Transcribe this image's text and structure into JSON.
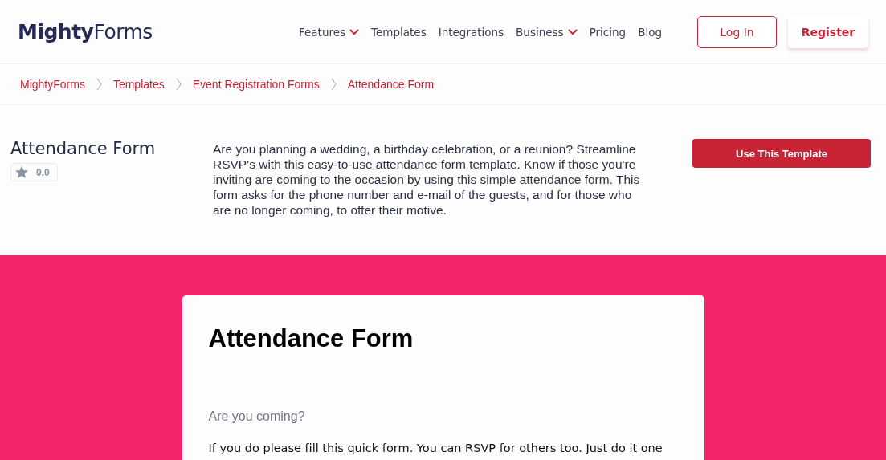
{
  "logo": "**Mighty**Forms",
  "nav": [
    {
      "label": "Features",
      "dropdown": true
    },
    {
      "label": "Templates",
      "dropdown": false
    },
    {
      "label": "Integrations",
      "dropdown": false
    },
    {
      "label": "Business",
      "dropdown": true
    },
    {
      "label": "Pricing",
      "dropdown": false
    },
    {
      "label": "Blog",
      "dropdown": false
    }
  ],
  "auth_buttons": [
    {
      "label": "Log In",
      "kind": "outline"
    },
    {
      "label": "Register",
      "kind": "raised"
    }
  ],
  "breadcrumb": [
    "MightyForms",
    "Templates",
    "Event Registration Forms",
    "Attendance Form"
  ],
  "template": {
    "title": "Attendance Form",
    "rating": "0.0",
    "description": "Are you planning a wedding, a birthday celebration, or a reunion? Streamline RSVP's with this easy-to-use attendance form template. Know if those you're inviting are coming to the occasion by using this simple attendance form. This form asks for the phone number and e-mail of the guests, and for those who are no longer coming, to offer their motive.",
    "action": "Use This Template"
  },
  "preview": {
    "title": "Attendance Form",
    "question": "Are you coming?",
    "text": "If you do please fill this quick form. You can RSVP for others too. Just do it one"
  }
}
